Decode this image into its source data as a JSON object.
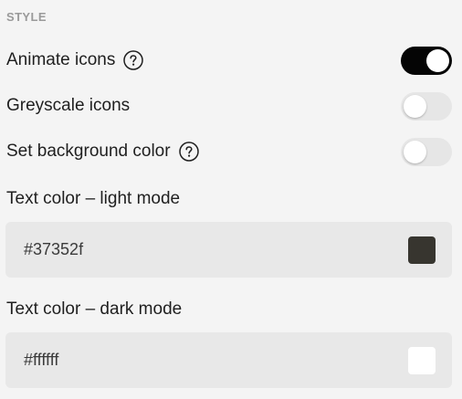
{
  "section": {
    "title": "STYLE"
  },
  "rows": [
    {
      "label": "Animate icons",
      "has_help": true,
      "toggle_state": "on"
    },
    {
      "label": "Greyscale icons",
      "has_help": false,
      "toggle_state": "off"
    },
    {
      "label": "Set background color",
      "has_help": true,
      "toggle_state": "off"
    }
  ],
  "text_color_light": {
    "label": "Text color – light mode",
    "value": "#37352f",
    "swatch_color": "#37352f"
  },
  "text_color_dark": {
    "label": "Text color – dark mode",
    "value": "#ffffff",
    "swatch_color": "#ffffff"
  },
  "icons": {
    "help": "question-circle-icon"
  },
  "colors": {
    "toggle_on": "#050505",
    "toggle_off": "#e6e6e6",
    "field_background": "#e8e8e8"
  }
}
